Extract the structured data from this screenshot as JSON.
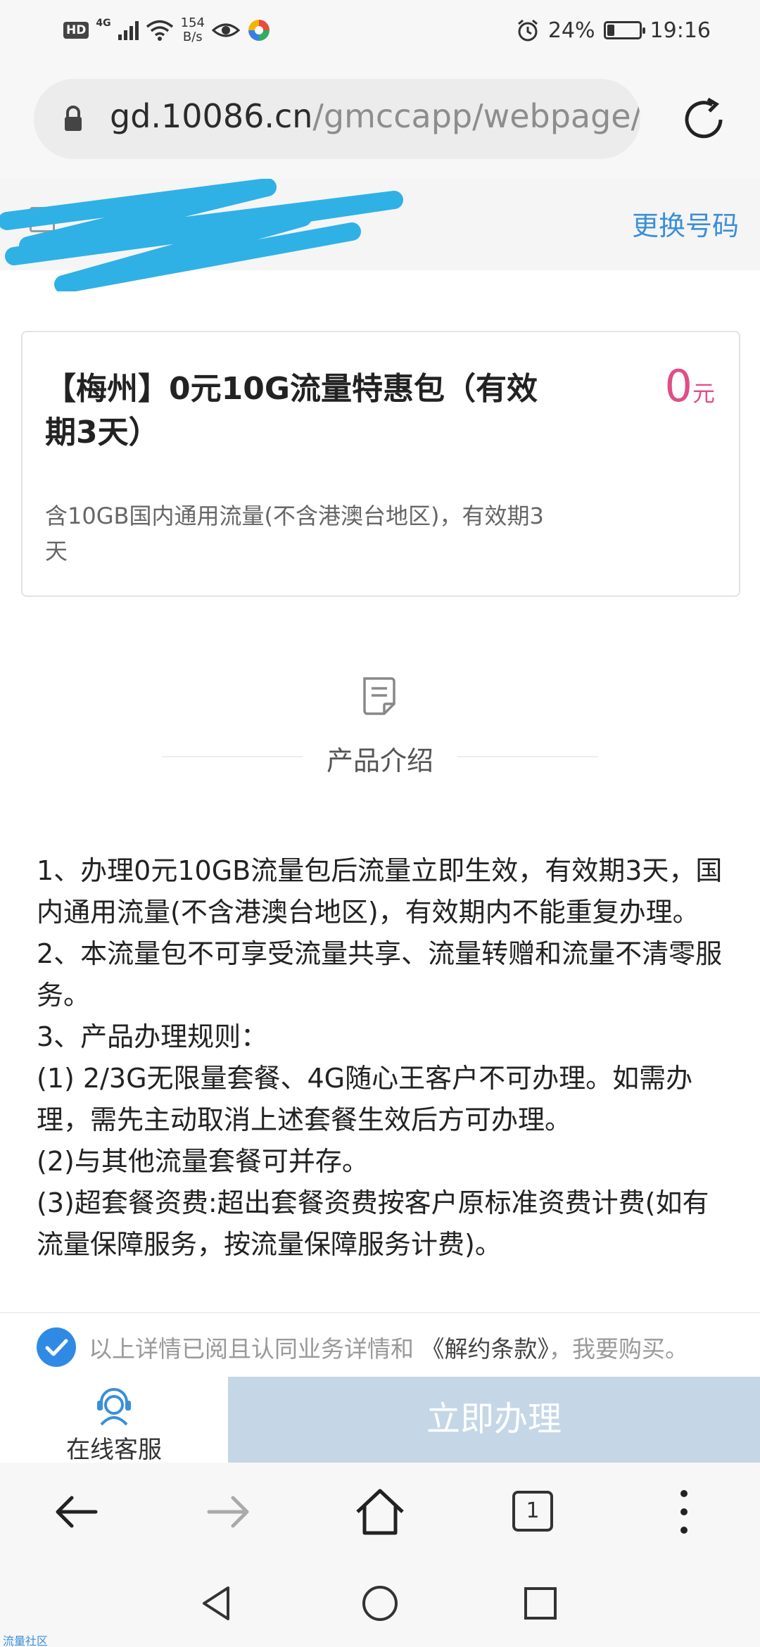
{
  "status_bar": {
    "hd": "HD",
    "network": "4G",
    "speed_value": "154",
    "speed_unit": "B/s",
    "battery_percent": "24%",
    "battery_level": 0.24,
    "time": "19:16"
  },
  "address_bar": {
    "domain": "gd.10086.cn",
    "path": "/gmccapp/webpage/s"
  },
  "account_bar": {
    "change_number": "更换号码"
  },
  "product": {
    "title": "【梅州】0元10G流量特惠包（有效期3天）",
    "price_value": "0",
    "price_unit": "元",
    "description": "含10GB国内通用流量(不含港澳台地区)，有效期3天"
  },
  "section": {
    "title": "产品介绍"
  },
  "details": [
    "1、办理0元10GB流量包后流量立即生效，有效期3天，国内通用流量(不含港澳台地区)，有效期内不能重复办理。",
    "2、本流量包不可享受流量共享、流量转赠和流量不清零服务。",
    "3、产品办理规则：",
    "(1) 2/3G无限量套餐、4G随心王客户不可办理。如需办理，需先主动取消上述套餐生效后方可办理。",
    "(2)与其他流量套餐可并存。",
    "(3)超套餐资费:超出套餐资费按客户原标准资费计费(如有流量保障服务，按流量保障服务计费)。"
  ],
  "agreement": {
    "prefix": "以上详情已阅且认同业务详情和",
    "terms": "《解约条款》",
    "suffix": "，我要购买。"
  },
  "actions": {
    "service_label": "在线客服",
    "submit_label": "立即办理"
  },
  "browser_nav": {
    "tab_count": "1"
  },
  "watermark": "流量社区"
}
